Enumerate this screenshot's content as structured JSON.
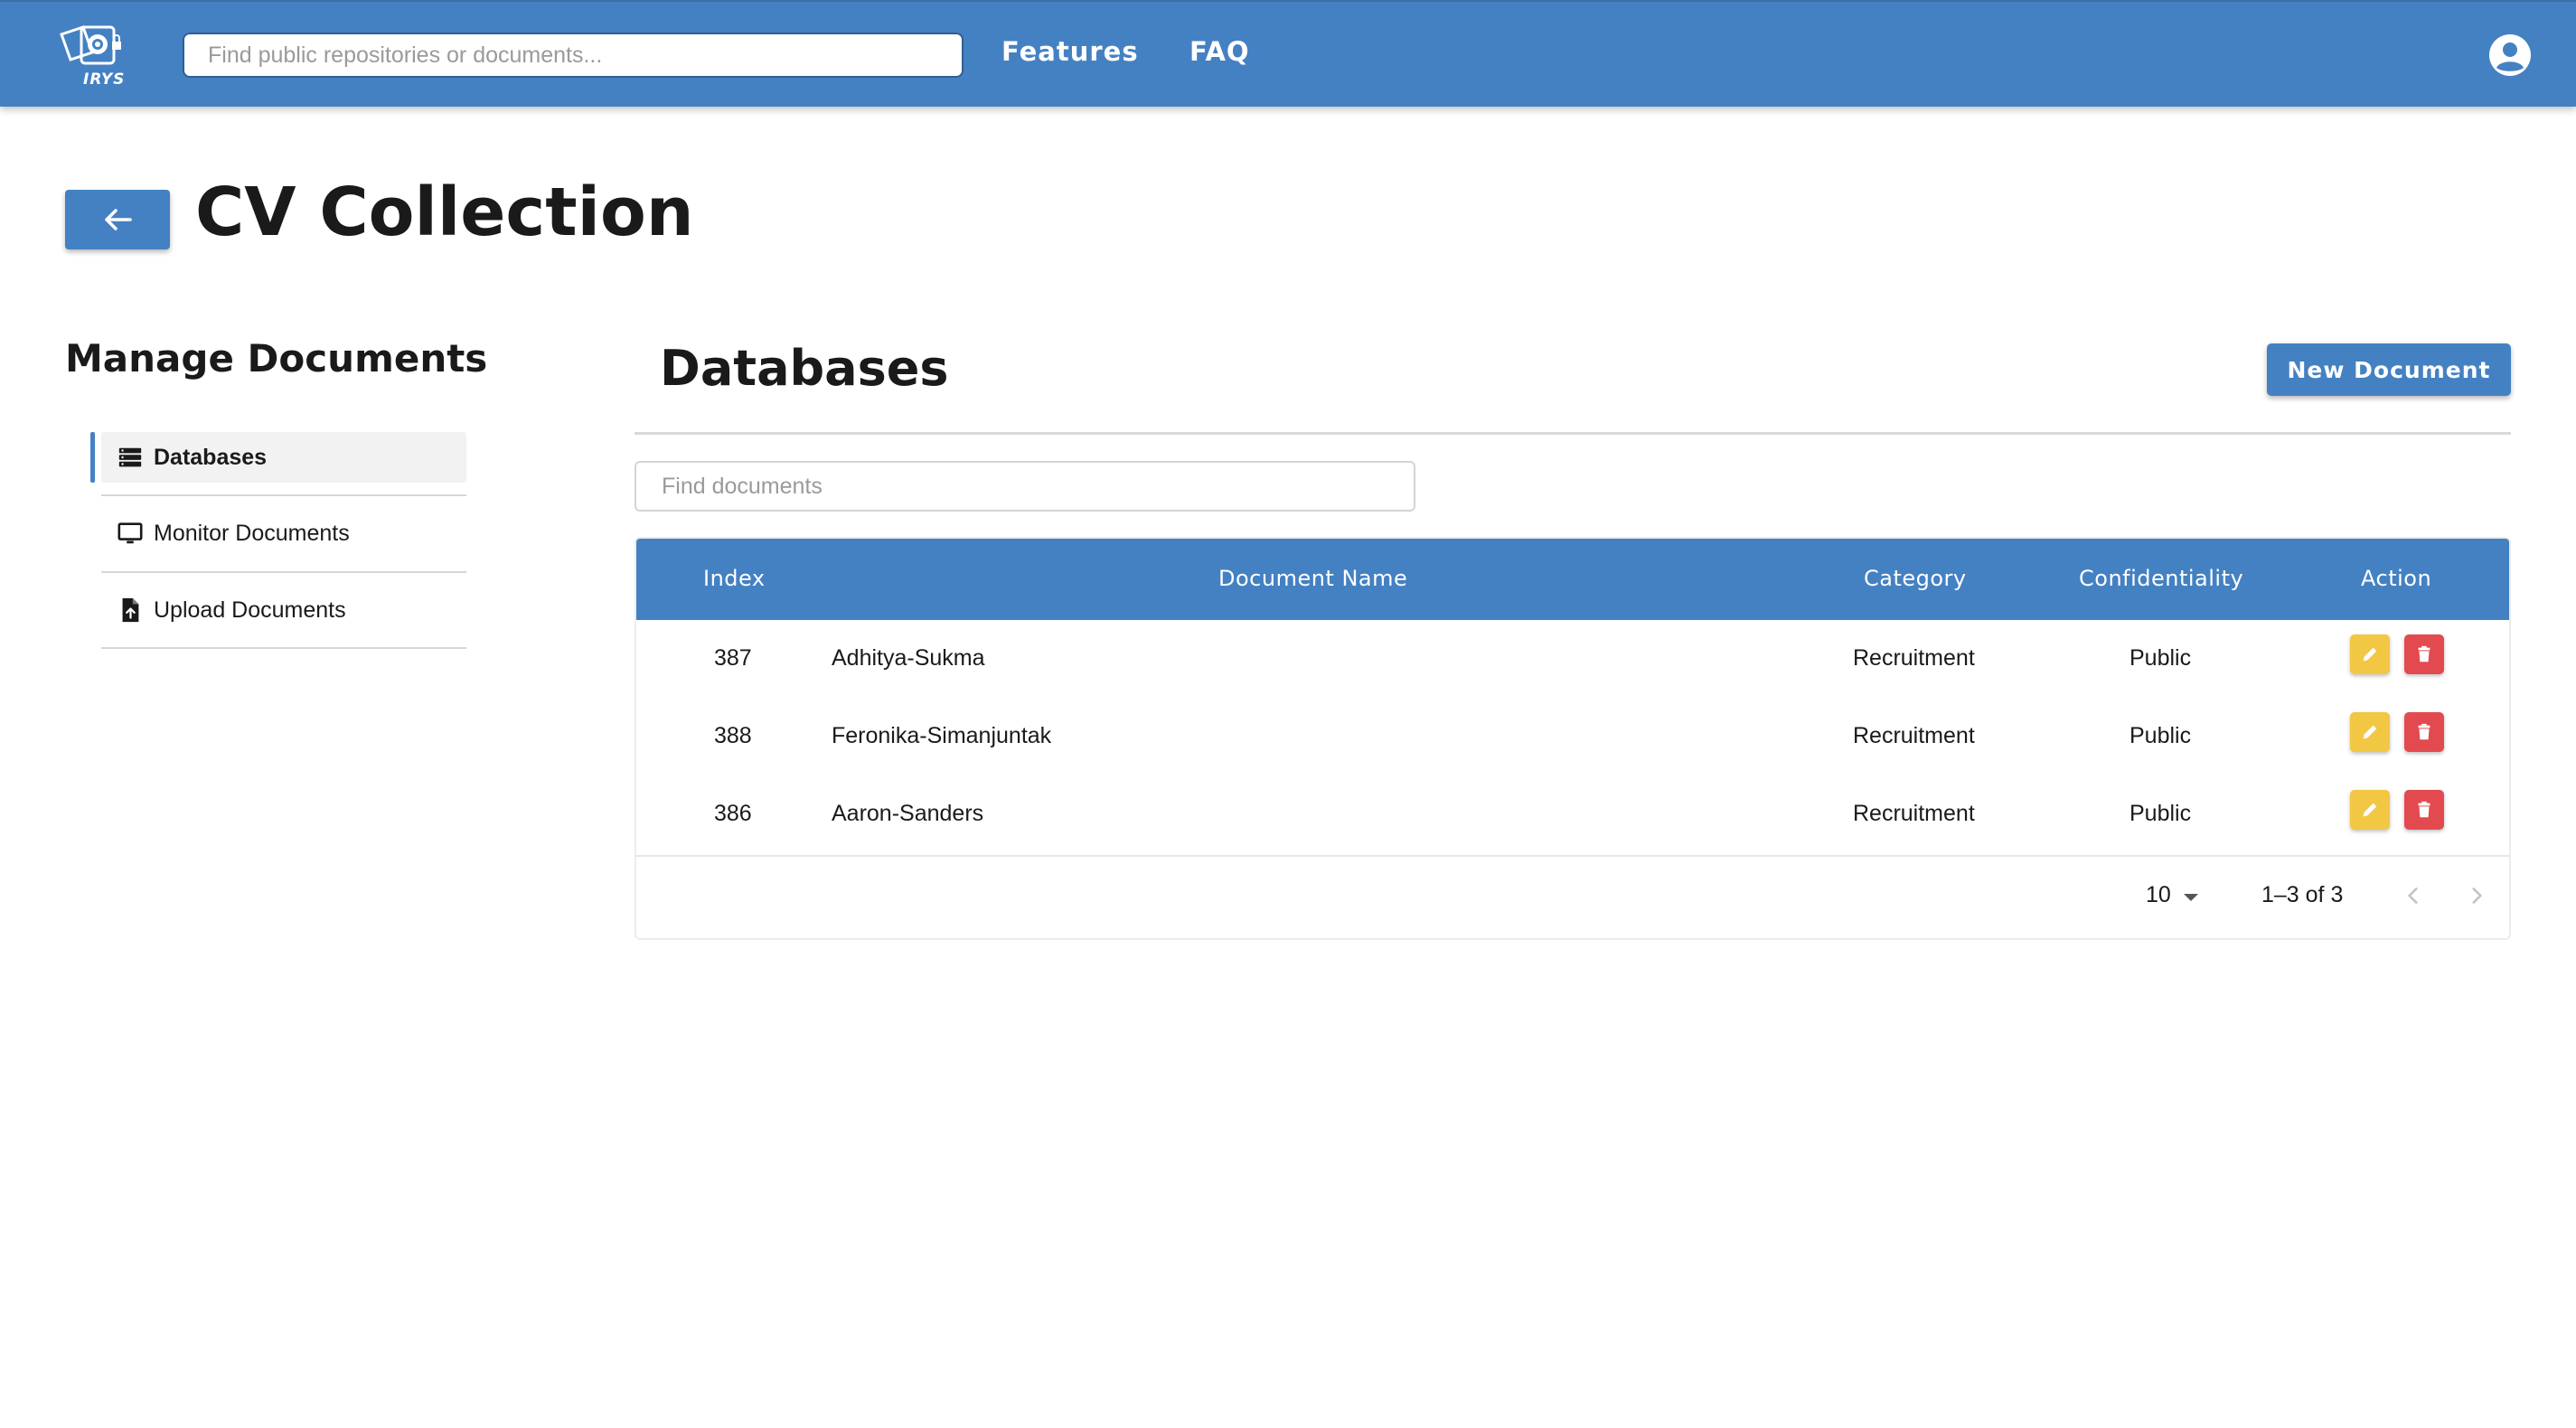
{
  "nav": {
    "logo_text": "IRYS",
    "search_placeholder": "Find public repositories or documents...",
    "links": [
      "Features",
      "FAQ"
    ],
    "account_icon": "account-circle-icon"
  },
  "header": {
    "back_icon": "arrow-left-icon",
    "title": "CV Collection"
  },
  "sidebar": {
    "title": "Manage Documents",
    "items": [
      {
        "label": "Databases",
        "icon": "database-icon",
        "active": true
      },
      {
        "label": "Monitor Documents",
        "icon": "monitor-icon",
        "active": false
      },
      {
        "label": "Upload Documents",
        "icon": "file-upload-icon",
        "active": false
      }
    ]
  },
  "main": {
    "title": "Databases",
    "new_button_label": "New Document",
    "search_placeholder": "Find documents",
    "table": {
      "columns": [
        "Index",
        "Document Name",
        "Category",
        "Confidentiality",
        "Action"
      ],
      "rows": [
        {
          "index": "387",
          "name": "Adhitya-Sukma",
          "category": "Recruitment",
          "confidentiality": "Public"
        },
        {
          "index": "388",
          "name": "Feronika-Simanjuntak",
          "category": "Recruitment",
          "confidentiality": "Public"
        },
        {
          "index": "386",
          "name": "Aaron-Sanders",
          "category": "Recruitment",
          "confidentiality": "Public"
        }
      ],
      "actions": {
        "edit_icon": "pencil-icon",
        "delete_icon": "trash-icon"
      }
    },
    "pagination": {
      "rows_per_page": "10",
      "range": "1–3 of 3"
    }
  },
  "colors": {
    "primary": "#4481c3",
    "edit": "#f2c744",
    "delete": "#e24a4f"
  }
}
